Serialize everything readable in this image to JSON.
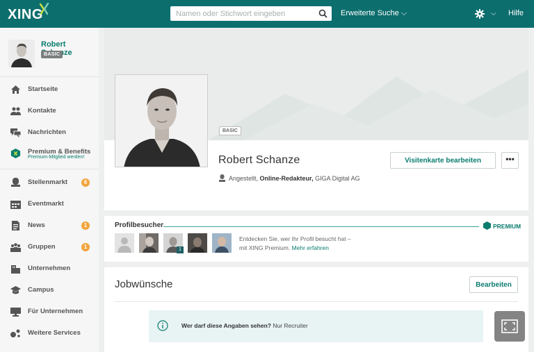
{
  "topbar": {
    "logo": "XING",
    "search_placeholder": "Namen oder Stichwort eingeben",
    "advanced_search": "Erweiterte Suche",
    "help": "Hilfe"
  },
  "sidebar": {
    "user_name": "Robert Schanze",
    "membership": "BASIC",
    "items": [
      {
        "label": "Startseite",
        "icon": "home-icon"
      },
      {
        "label": "Kontakte",
        "icon": "contacts-icon"
      },
      {
        "label": "Nachrichten",
        "icon": "messages-icon"
      },
      {
        "label": "Premium & Benefits",
        "sub": "Premium-Mitglied werden!",
        "icon": "premium-icon"
      },
      {
        "label": "Stellenmarkt",
        "icon": "jobs-icon",
        "badge": "6"
      },
      {
        "label": "Eventmarkt",
        "icon": "events-icon"
      },
      {
        "label": "News",
        "icon": "news-icon",
        "badge": "1"
      },
      {
        "label": "Gruppen",
        "icon": "groups-icon",
        "badge": "1"
      },
      {
        "label": "Unternehmen",
        "icon": "companies-icon"
      },
      {
        "label": "Campus",
        "icon": "campus-icon"
      },
      {
        "label": "Für Unternehmen",
        "icon": "for-companies-icon"
      },
      {
        "label": "Weitere Services",
        "icon": "more-services-icon"
      }
    ]
  },
  "profile": {
    "membership_tag": "BASIC",
    "name": "Robert Schanze",
    "status": "Angestellt,",
    "position": "Online-Redakteur,",
    "company": "GIGA Digital AG",
    "edit_card_button": "Visitenkarte bearbeiten",
    "more_button": "•••"
  },
  "visitors": {
    "title": "Profilbesucher",
    "premium_label": "PREMIUM",
    "extra_count": "1",
    "text": "Entdecken Sie, wer Ihr Profil besucht hat –",
    "text2": "mit XING Premium.",
    "link": "Mehr erfahren"
  },
  "jobs": {
    "title": "Jobwünsche",
    "edit_button": "Bearbeiten",
    "visibility_question": "Wer darf diese Angaben sehen?",
    "visibility_answer": "Nur Recruiter"
  },
  "colors": {
    "brand": "#0d6e6e",
    "accent": "#0a7c6f",
    "badge": "#f2a43c",
    "premium_line": "#38a396"
  }
}
